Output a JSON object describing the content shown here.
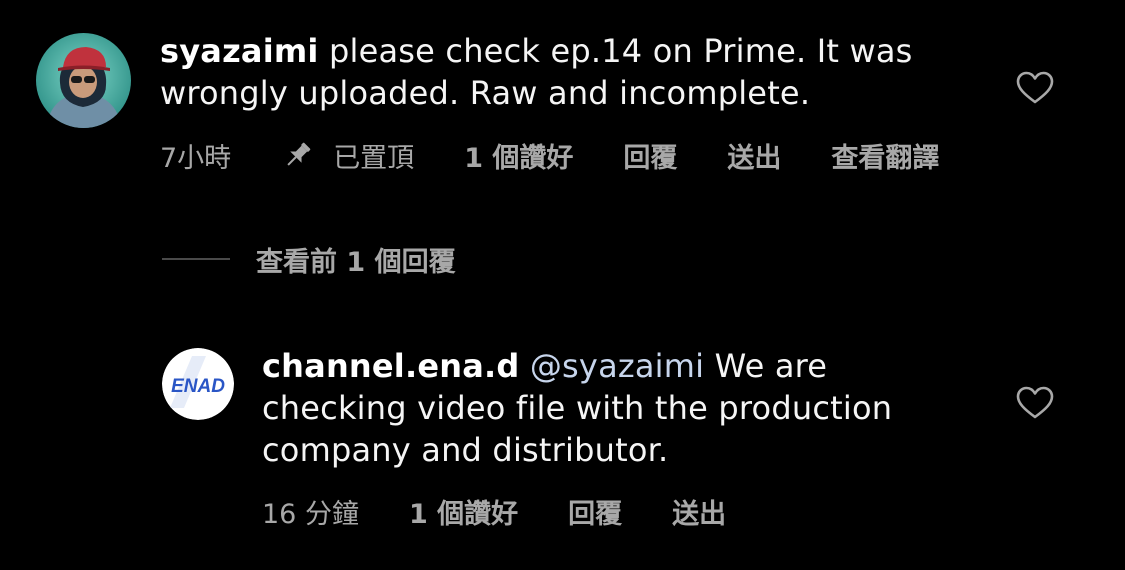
{
  "comments": [
    {
      "username": "syazaimi",
      "text": " please check ep.14 on Prime. It was wrongly uploaded. Raw and incomplete.",
      "time": "7小時",
      "pinned_label": "已置頂",
      "likes": "1 個讚好",
      "reply": "回覆",
      "send": "送出",
      "translate": "查看翻譯"
    },
    {
      "username": "channel.ena.d",
      "mention": " @syazaimi",
      "text": " We are checking video file with the production company and distributor.",
      "time": "16 分鐘",
      "likes": "1 個讚好",
      "reply": "回覆",
      "send": "送出",
      "avatar_logo": "ENAD"
    }
  ],
  "view_previous_replies": "查看前 1 個回覆",
  "colors": {
    "background": "#000000",
    "text_primary": "#f5f5f5",
    "text_secondary": "#a8a8a8",
    "mention": "#c7d5ec",
    "divider": "#4a4a4a"
  },
  "icons": {
    "like": "heart-outline-icon",
    "pin": "pushpin-icon"
  }
}
